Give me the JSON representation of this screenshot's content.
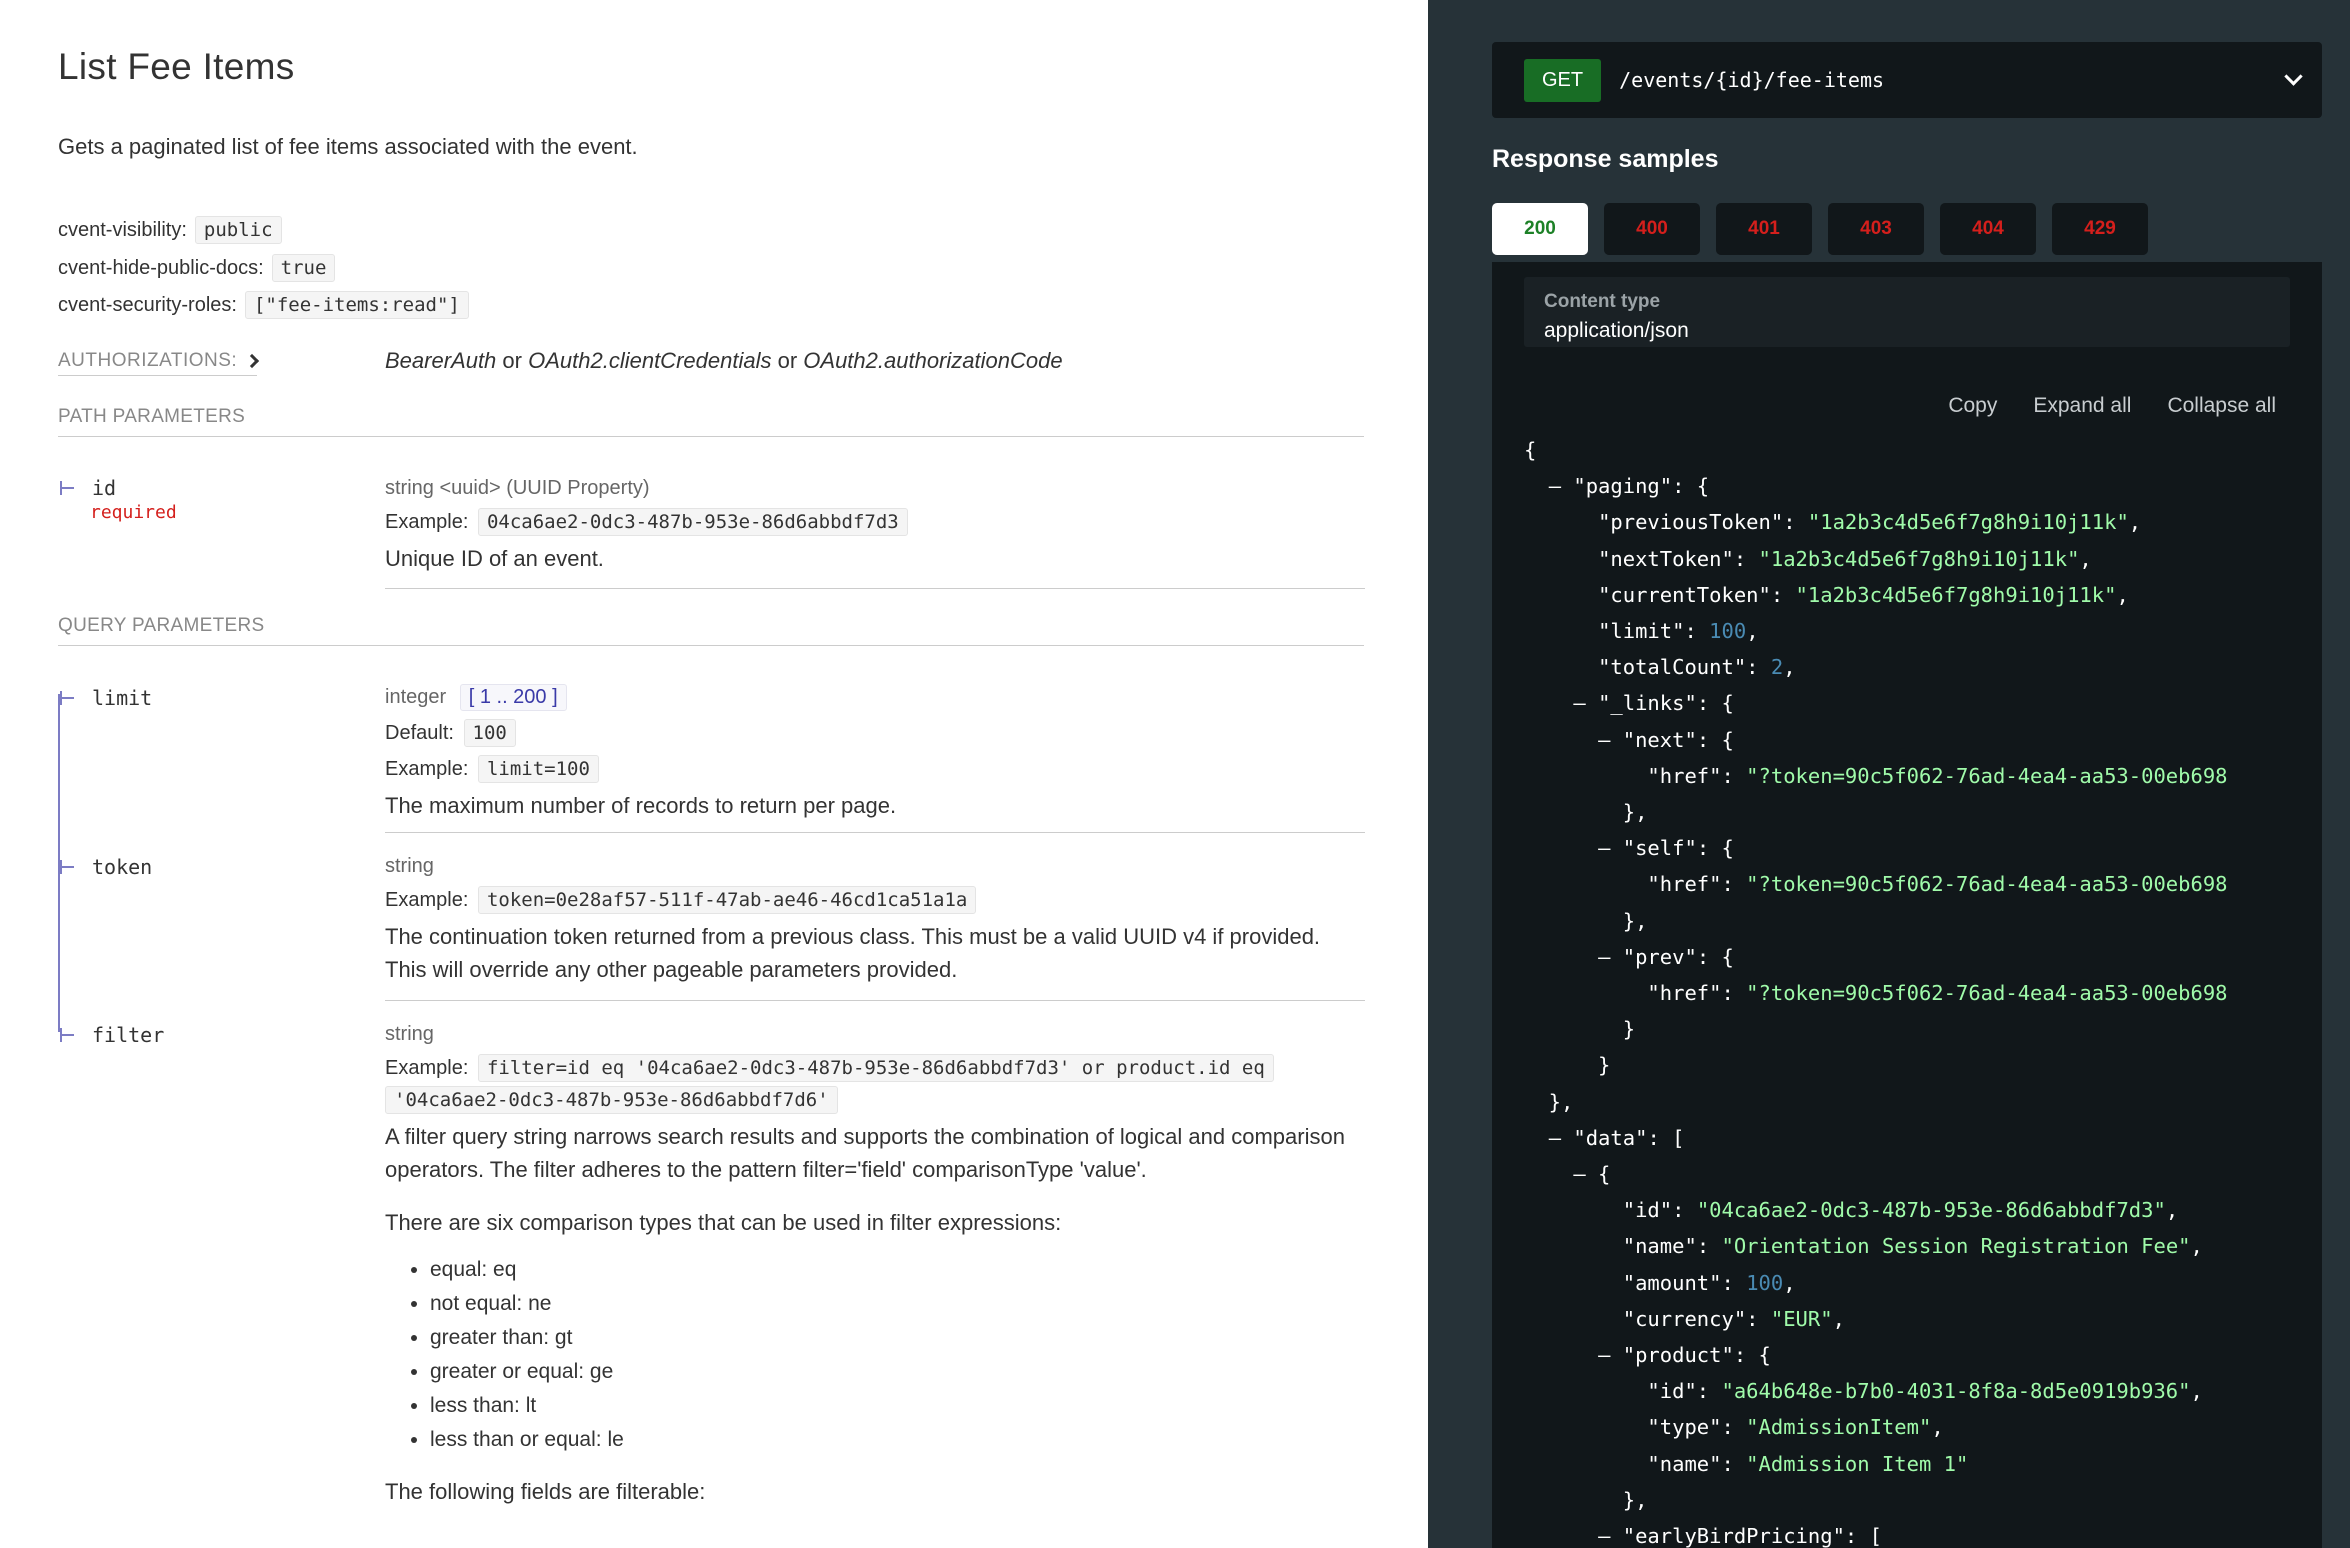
{
  "page": {
    "title": "List Fee Items",
    "description": "Gets a paginated list of fee items associated with the event."
  },
  "extensions": [
    {
      "label": "cvent-visibility:",
      "value": "public"
    },
    {
      "label": "cvent-hide-public-docs:",
      "value": "true"
    },
    {
      "label": "cvent-security-roles:",
      "value": "[\"fee-items:read\"]"
    }
  ],
  "authorizations": {
    "label": "AUTHORIZATIONS:",
    "items": [
      "BearerAuth",
      "OAuth2.clientCredentials",
      "OAuth2.authorizationCode"
    ],
    "separator": "or"
  },
  "path_parameters": {
    "heading": "PATH PARAMETERS",
    "params": [
      {
        "name": "id",
        "required_label": "required",
        "type": "string <uuid> (UUID Property)",
        "example_label": "Example:",
        "example": "04ca6ae2-0dc3-487b-953e-86d6abbdf7d3",
        "description": "Unique ID of an event."
      }
    ]
  },
  "query_parameters": {
    "heading": "QUERY PARAMETERS",
    "limit": {
      "name": "limit",
      "type": "integer",
      "range": "[ 1 .. 200 ]",
      "default_label": "Default:",
      "default": "100",
      "example_label": "Example:",
      "example": "limit=100",
      "description": "The maximum number of records to return per page."
    },
    "token": {
      "name": "token",
      "type": "string",
      "example_label": "Example:",
      "example": "token=0e28af57-511f-47ab-ae46-46cd1ca51a1a",
      "description": "The continuation token returned from a previous class. This must be a valid UUID v4 if provided. This will override any other pageable parameters provided."
    },
    "filter": {
      "name": "filter",
      "type": "string",
      "example_label": "Example:",
      "example_line1": "filter=id eq '04ca6ae2-0dc3-487b-953e-86d6abbdf7d3' or product.id eq",
      "example_line2": "'04ca6ae2-0dc3-487b-953e-86d6abbdf7d6'",
      "description": "A filter query string narrows search results and supports the combination of logical and comparison operators. The filter adheres to the pattern filter='field' comparisonType 'value'.",
      "ops_intro": "There are six comparison types that can be used in filter expressions:",
      "ops": [
        "equal: eq",
        "not equal: ne",
        "greater than: gt",
        "greater or equal: ge",
        "less than: lt",
        "less than or equal: le"
      ],
      "fields_intro": "The following fields are filterable:"
    }
  },
  "right_panel": {
    "method": "GET",
    "path": "/events/{id}/fee-items",
    "samples_title": "Response samples",
    "tabs": [
      "200",
      "400",
      "401",
      "403",
      "404",
      "429"
    ],
    "active_tab": "200",
    "content_type_label": "Content type",
    "content_type_value": "application/json",
    "actions": [
      "Copy",
      "Expand all",
      "Collapse all"
    ],
    "colors": {
      "panel_bg": "#263238",
      "code_bg": "#11171a",
      "string": "#a0fbaa",
      "number": "#4a8bb3",
      "error_tab": "#d41f1c",
      "ok_tab": "#1d8127",
      "get_badge": "#186d25"
    }
  },
  "json_sample": {
    "k_paging": "\"paging\"",
    "k_previousToken": "\"previousToken\"",
    "v_previousToken": "\"1a2b3c4d5e6f7g8h9i10j11k\"",
    "k_nextToken": "\"nextToken\"",
    "v_nextToken": "\"1a2b3c4d5e6f7g8h9i10j11k\"",
    "k_currentToken": "\"currentToken\"",
    "v_currentToken": "\"1a2b3c4d5e6f7g8h9i10j11k\"",
    "k_limit": "\"limit\"",
    "v_limit": "100",
    "k_totalCount": "\"totalCount\"",
    "v_totalCount": "2",
    "k_links": "\"_links\"",
    "k_next": "\"next\"",
    "k_self": "\"self\"",
    "k_prev": "\"prev\"",
    "k_href": "\"href\"",
    "v_href": "\"?token=90c5f062-76ad-4ea4-aa53-00eb698",
    "k_data": "\"data\"",
    "k_id": "\"id\"",
    "v_id": "\"04ca6ae2-0dc3-487b-953e-86d6abbdf7d3\"",
    "k_name": "\"name\"",
    "v_name": "\"Orientation Session Registration Fee\"",
    "k_amount": "\"amount\"",
    "v_amount": "100",
    "k_currency": "\"currency\"",
    "v_currency": "\"EUR\"",
    "k_product": "\"product\"",
    "v_product_id": "\"a64b648e-b7b0-4031-8f8a-8d5e0919b936\"",
    "k_type": "\"type\"",
    "v_product_type": "\"AdmissionItem\"",
    "v_product_name": "\"Admission Item 1\"",
    "k_earlyBirdPricing": "\"earlyBirdPricing\""
  }
}
